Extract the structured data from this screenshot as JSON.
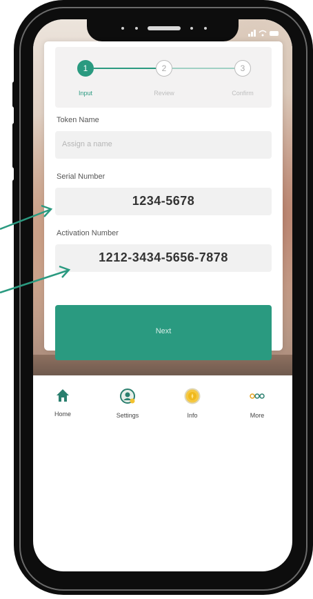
{
  "stepper": {
    "steps": [
      {
        "number": "1",
        "label": "Input",
        "state": "active"
      },
      {
        "number": "2",
        "label": "Review",
        "state": "idle"
      },
      {
        "number": "3",
        "label": "Confirm",
        "state": "idle"
      }
    ]
  },
  "form": {
    "token_name": {
      "label": "Token Name",
      "placeholder": "Assign a name",
      "value": ""
    },
    "serial_number": {
      "label": "Serial Number",
      "value": "1234-5678"
    },
    "activation_number": {
      "label": "Activation Number",
      "value": "1212-3434-5656-7878"
    }
  },
  "next_button": {
    "label": "Next"
  },
  "tabbar": {
    "items": [
      {
        "label": "Home",
        "icon": "home-icon"
      },
      {
        "label": "Settings",
        "icon": "settings-user-icon"
      },
      {
        "label": "Info",
        "icon": "info-coin-icon"
      },
      {
        "label": "More",
        "icon": "more-dots-icon"
      }
    ]
  },
  "colors": {
    "accent": "#2a9a80",
    "info_icon": "#f2c230",
    "phone_frame": "#0d0d0d"
  }
}
